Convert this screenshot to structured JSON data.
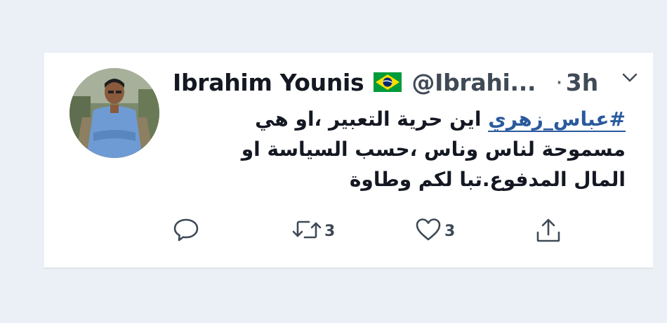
{
  "tweet": {
    "author_name": "Ibrahim Younis",
    "handle": "@Ibrahi...",
    "separator": "·",
    "time": "3h",
    "flag_icon": "brazil-flag",
    "text": {
      "hashtag": "#عباس_زهري",
      "line1_rest": " اين حرية التعبير ،او هي",
      "line2": "مسموحة لناس وناس ،حسب السياسة او",
      "line3": "المال المدفوع.تبا لكم وطاوة"
    },
    "actions": {
      "reply_icon": "reply-icon",
      "retweet_icon": "retweet-icon",
      "retweet_count": "3",
      "like_icon": "heart-icon",
      "like_count": "3",
      "share_icon": "share-icon"
    }
  },
  "colors": {
    "background": "#ebeff6",
    "card": "#ffffff",
    "hashtag": "#2a5a9e",
    "icon": "#3f4a56"
  }
}
